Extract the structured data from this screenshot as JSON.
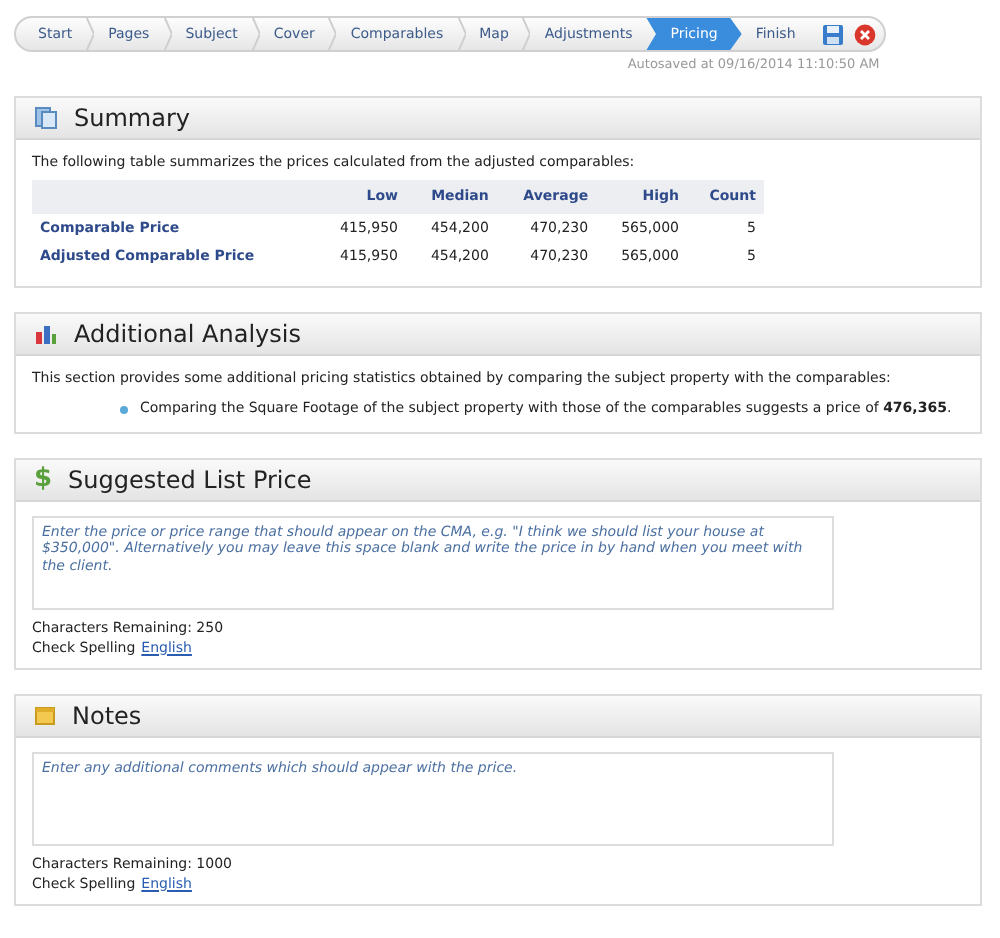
{
  "steps": [
    {
      "label": "Start",
      "selected": false
    },
    {
      "label": "Pages",
      "selected": false
    },
    {
      "label": "Subject",
      "selected": false
    },
    {
      "label": "Cover",
      "selected": false
    },
    {
      "label": "Comparables",
      "selected": false
    },
    {
      "label": "Map",
      "selected": false
    },
    {
      "label": "Adjustments",
      "selected": false
    },
    {
      "label": "Pricing",
      "selected": true
    },
    {
      "label": "Finish",
      "selected": false
    }
  ],
  "autosave": "Autosaved at 09/16/2014 11:10:50 AM",
  "summary": {
    "title": "Summary",
    "intro": "The following table summarizes the prices calculated from the adjusted comparables:",
    "columns": [
      "Low",
      "Median",
      "Average",
      "High",
      "Count"
    ],
    "rows": [
      {
        "label": "Comparable Price",
        "cells": [
          "415,950",
          "454,200",
          "470,230",
          "565,000",
          "5"
        ]
      },
      {
        "label": "Adjusted Comparable Price",
        "cells": [
          "415,950",
          "454,200",
          "470,230",
          "565,000",
          "5"
        ]
      }
    ]
  },
  "analysis": {
    "title": "Additional Analysis",
    "intro": "This section provides some additional pricing statistics obtained by comparing the subject property with the comparables:",
    "bullets": [
      "Comparing the Square Footage of the subject property with those of the comparables suggests a price of **476,365**."
    ]
  },
  "list_price": {
    "icon": "$",
    "title": "Suggested List Price",
    "placeholder": "Enter the price or price range that should appear on the CMA, e.g. \"I think we should list your house at $350,000\". Alternatively you may leave this space blank and write the price in by hand when you meet with the client.",
    "remaining": "Characters Remaining: 250",
    "spell_label": "Check Spelling",
    "spell_link": "English"
  },
  "notes": {
    "title": "Notes",
    "placeholder": "Enter any additional comments which should appear with the price.",
    "remaining": "Characters Remaining: 1000",
    "spell_label": "Check Spelling",
    "spell_link": "English"
  }
}
